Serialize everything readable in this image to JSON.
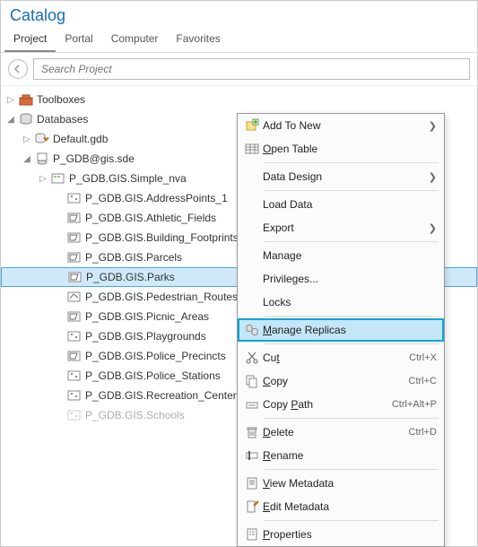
{
  "title": "Catalog",
  "tabs": [
    "Project",
    "Portal",
    "Computer",
    "Favorites"
  ],
  "active_tab_index": 0,
  "search_placeholder": "Search Project",
  "tree": {
    "toolboxes_label": "Toolboxes",
    "databases_label": "Databases",
    "default_gdb": "Default.gdb",
    "connection_label": "P_GDB@gis.sde",
    "layers": [
      "P_GDB.GIS.Simple_nva",
      "P_GDB.GIS.AddressPoints_1",
      "P_GDB.GIS.Athletic_Fields",
      "P_GDB.GIS.Building_Footprints",
      "P_GDB.GIS.Parcels",
      "P_GDB.GIS.Parks",
      "P_GDB.GIS.Pedestrian_Routes",
      "P_GDB.GIS.Picnic_Areas",
      "P_GDB.GIS.Playgrounds",
      "P_GDB.GIS.Police_Precincts",
      "P_GDB.GIS.Police_Stations",
      "P_GDB.GIS.Recreation_Centers",
      "P_GDB.GIS.Schools"
    ],
    "selected_layer_index": 5
  },
  "context_menu": {
    "items": [
      {
        "label": "Add To New",
        "icon": "add-to-new",
        "submenu": true
      },
      {
        "label": "Open Table",
        "icon": "table",
        "accel": "O"
      },
      {
        "sep": true
      },
      {
        "label": "Data Design",
        "submenu": true
      },
      {
        "sep": true
      },
      {
        "label": "Load Data"
      },
      {
        "label": "Export",
        "submenu": true
      },
      {
        "sep": true
      },
      {
        "label": "Manage"
      },
      {
        "label": "Privileges..."
      },
      {
        "label": "Locks"
      },
      {
        "sep": true
      },
      {
        "label": "Manage Replicas",
        "icon": "replicas",
        "accel": "M",
        "highlighted": true
      },
      {
        "sep": true
      },
      {
        "label": "Cut",
        "icon": "cut",
        "shortcut": "Ctrl+X",
        "accel_idx": 2
      },
      {
        "label": "Copy",
        "icon": "copy",
        "shortcut": "Ctrl+C",
        "accel": "C"
      },
      {
        "label": "Copy Path",
        "icon": "copy-path",
        "shortcut": "Ctrl+Alt+P",
        "accel_idx": 5
      },
      {
        "sep": true
      },
      {
        "label": "Delete",
        "icon": "delete",
        "shortcut": "Ctrl+D",
        "accel": "D"
      },
      {
        "label": "Rename",
        "icon": "rename",
        "accel": "R"
      },
      {
        "sep": true
      },
      {
        "label": "View Metadata",
        "icon": "view-meta",
        "accel": "V"
      },
      {
        "label": "Edit Metadata",
        "icon": "edit-meta",
        "accel": "E"
      },
      {
        "sep": true
      },
      {
        "label": "Properties",
        "icon": "properties",
        "accel": "P"
      }
    ]
  }
}
